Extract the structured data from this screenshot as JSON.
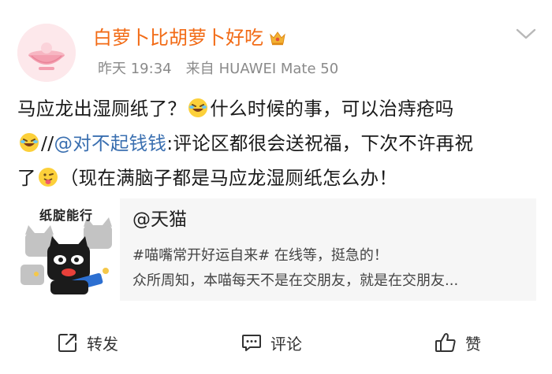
{
  "post": {
    "author": "白萝卜比胡萝卜好吃",
    "time": "昨天 19:34",
    "source_prefix": "来自",
    "device": "HUAWEI Mate 50",
    "text": {
      "line1_a": "马应龙出湿厕纸了？",
      "line1_b": "什么时候的事，可以治痔疮吗",
      "line2_a": "//",
      "line2_mention": "@对不起钱钱",
      "line2_b": ":评论区都很会送祝福，下次不许再祝",
      "line3_a": "了",
      "line3_b": "（现在满脑子都是马应龙湿厕纸怎么办！"
    }
  },
  "card": {
    "thumb_title": "纸腚能行",
    "title": "@天猫",
    "line1": "#喵嘴常开好运自来# 在线等，挺急的！",
    "line2": "众所周知，本喵每天不是在交朋友，就是在交朋友..."
  },
  "actions": {
    "repost": "转发",
    "comment": "评论",
    "like": "赞"
  },
  "colors": {
    "username": "#f26b16",
    "mention": "#3a6fb0",
    "meta": "#8a8a8a"
  },
  "icons": {
    "crown": "crown-icon",
    "chevron": "chevron-down-icon",
    "laugh": "laughing-emoji-icon",
    "tongue": "tongue-out-emoji-icon",
    "repost": "repost-icon",
    "comment": "comment-icon",
    "like": "thumbs-up-icon"
  }
}
